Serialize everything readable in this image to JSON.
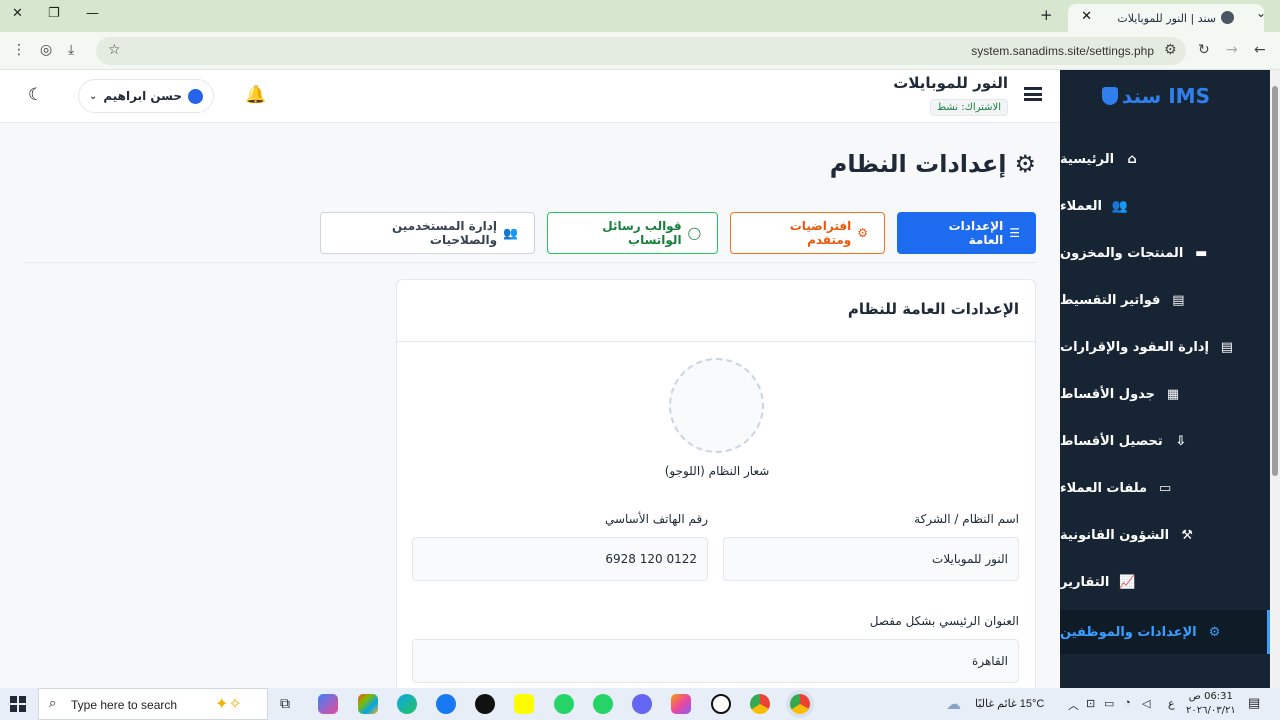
{
  "browser": {
    "tab_title": "سند | النور للموبايلات",
    "url": "system.sanadims.site/settings.php"
  },
  "sidebar": {
    "brand": "سند IMS",
    "items": [
      {
        "label": "الرئيسية",
        "icon": "home-icon"
      },
      {
        "label": "العملاء",
        "icon": "users-icon"
      },
      {
        "label": "المنتجات والمخزون",
        "icon": "box-icon"
      },
      {
        "label": "فواتير التقسيط",
        "icon": "invoice-icon"
      },
      {
        "label": "إدارة العقود والإقرارات",
        "icon": "contract-icon"
      },
      {
        "label": "جدول الأقساط",
        "icon": "calendar-icon"
      },
      {
        "label": "تحصيل الأقساط",
        "icon": "collect-icon"
      },
      {
        "label": "ملفات العملاء",
        "icon": "folder-icon"
      },
      {
        "label": "الشؤون القانونية",
        "icon": "gavel-icon"
      },
      {
        "label": "التقارير",
        "icon": "chart-icon"
      },
      {
        "label": "الإعدادات والموظفين",
        "icon": "gear-icon",
        "active": true
      }
    ]
  },
  "topbar": {
    "shop_name": "النور للموبايلات",
    "subscription": "الاشتراك: نشط",
    "user_name": "حسن ابراهيم"
  },
  "main": {
    "title": "إعدادات النظام",
    "tabs": [
      {
        "label": "الإعدادات العامة"
      },
      {
        "label": "افتراضيات ومتقدم"
      },
      {
        "label": "قوالب رسائل الواتساب"
      },
      {
        "label": "إدارة المستخدمين والصلاحيات"
      }
    ],
    "card": {
      "title": "الإعدادات العامة للنظام",
      "logo_label": "شعار النظام (اللوجو)",
      "fields": {
        "system_name_label": "اسم النظام / الشركة",
        "system_name_value": "النور للموبايلات",
        "phone_label": "رقم الهاتف الأساسي",
        "phone_value": "0122 120 6928",
        "address_label": "العنوان الرئيسي بشكل مفصل",
        "address_value": "القاهرة"
      }
    }
  },
  "taskbar": {
    "search_placeholder": "Type here to search",
    "weather": "15°C  غائم غالبًا",
    "time": "06:31 ص",
    "date": "٢٠٢٦/٠٣/٢١",
    "lang": "ع"
  }
}
